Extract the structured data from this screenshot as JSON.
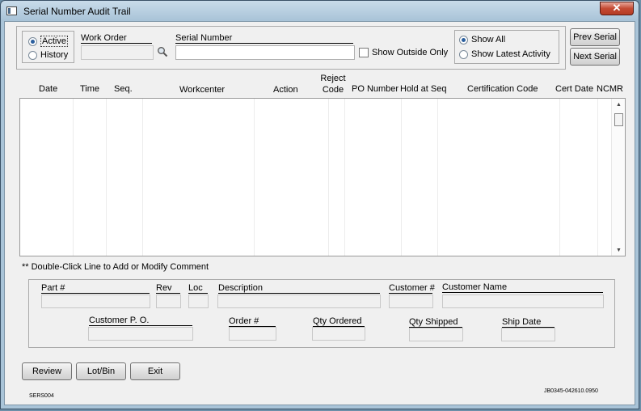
{
  "window": {
    "title": "Serial Number Audit Trail",
    "close_glyph": "✕"
  },
  "mode": {
    "active_label": "Active",
    "history_label": "History",
    "selected": "Active"
  },
  "work_order": {
    "label": "Work Order",
    "value": ""
  },
  "serial_number": {
    "label": "Serial Number",
    "value": ""
  },
  "show_outside_only": {
    "label": "Show Outside Only",
    "checked": false
  },
  "activity_filter": {
    "show_all_label": "Show All",
    "show_latest_label": "Show Latest Activity",
    "selected": "Show All"
  },
  "nav": {
    "prev_label": "Prev Serial",
    "next_label": "Next Serial"
  },
  "grid": {
    "columns": [
      {
        "label": "Date"
      },
      {
        "label": "Time"
      },
      {
        "label": "Seq."
      },
      {
        "label": "Workcenter"
      },
      {
        "label": "Action"
      },
      {
        "label_top": "Reject",
        "label": "Code"
      },
      {
        "label": "PO Number"
      },
      {
        "label": "Hold at Seq"
      },
      {
        "label": "Certification Code"
      },
      {
        "label": "Cert Date"
      },
      {
        "label": "NCMR"
      }
    ],
    "rows": []
  },
  "hint": "** Double-Click Line to Add or Modify Comment",
  "details": {
    "part_label": "Part #",
    "rev_label": "Rev",
    "loc_label": "Loc",
    "description_label": "Description",
    "customer_num_label": "Customer #",
    "customer_name_label": "Customer Name",
    "customer_po_label": "Customer P. O.",
    "order_label": "Order #",
    "qty_ordered_label": "Qty Ordered",
    "qty_shipped_label": "Qty Shipped",
    "ship_date_label": "Ship Date"
  },
  "buttons": {
    "review": "Review",
    "lot_bin": "Lot/Bin",
    "exit": "Exit"
  },
  "footer": {
    "form_id": "SERS004",
    "build_id": "JB0345-042610.0950"
  }
}
